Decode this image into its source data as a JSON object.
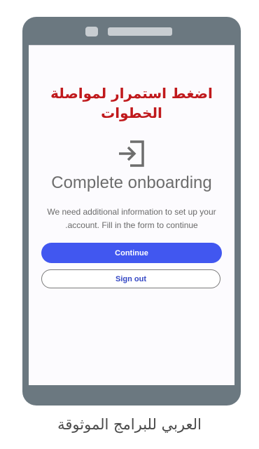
{
  "overlay": {
    "caption_line1": "اضغط استمرار لمواصلة",
    "caption_line2": "الخطوات",
    "caption_color": "#c0191c"
  },
  "onboarding": {
    "icon": "login-arrow-icon",
    "title": "Complete onboarding",
    "description_line1": "We need additional information to set up your",
    "description_line2": ".account. Fill in the form to continue",
    "continue_label": "Continue",
    "signout_label": "Sign out",
    "accent_color": "#4157f0"
  },
  "footer": {
    "caption": "العربي للبرامج الموثوقة"
  }
}
